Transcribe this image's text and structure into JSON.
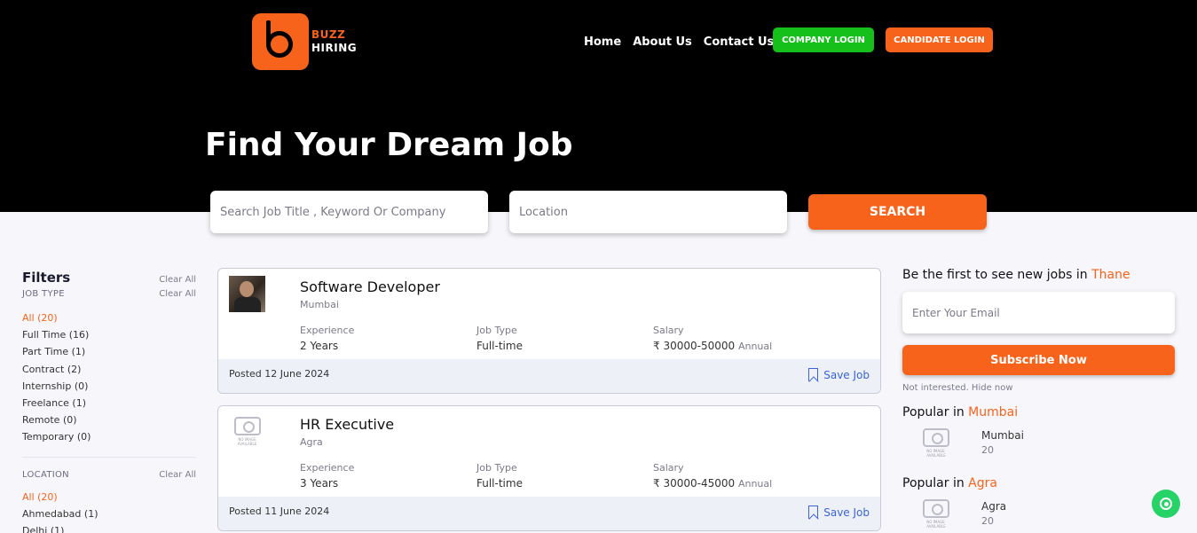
{
  "brand": {
    "line1": "BUZZ",
    "line2": "HIRING",
    "accent": "#f7631b"
  },
  "nav": {
    "home": "Home",
    "about": "About Us",
    "contact": "Contact Us"
  },
  "auth": {
    "company_login": "COMPANY LOGIN",
    "candidate_login": "CANDIDATE LOGIN"
  },
  "hero": {
    "title": "Find Your Dream Job",
    "search_placeholder": "Search Job Title , Keyword Or Company",
    "location_placeholder": "Location",
    "search_button": "SEARCH"
  },
  "filters": {
    "title": "Filters",
    "clear_all": "Clear All",
    "job_type": {
      "label": "JOB TYPE",
      "clear": "Clear All",
      "items": [
        "All (20)",
        "Full Time (16)",
        "Part Time (1)",
        "Contract (2)",
        "Internship (0)",
        "Freelance (1)",
        "Remote (0)",
        "Temporary (0)"
      ]
    },
    "location": {
      "label": "LOCATION",
      "clear": "Clear All",
      "items": [
        "All (20)",
        "Ahmedabad (1)",
        "Delhi (1)"
      ]
    }
  },
  "jobs": [
    {
      "title": "Software Developer",
      "city": "Mumbai",
      "experience_label": "Experience",
      "experience": "2 Years",
      "type_label": "Job Type",
      "type": "Full-time",
      "salary_label": "Salary",
      "salary": "₹ 30000-50000",
      "salary_period": "Annual",
      "posted": "Posted 12 June 2024",
      "save": "Save Job"
    },
    {
      "title": "HR Executive",
      "city": "Agra",
      "experience_label": "Experience",
      "experience": "3 Years",
      "type_label": "Job Type",
      "type": "Full-time",
      "salary_label": "Salary",
      "salary": "₹ 30000-45000",
      "salary_period": "Annual",
      "posted": "Posted 11 June 2024",
      "save": "Save Job"
    }
  ],
  "no_image": {
    "line1": "NO IMAGE",
    "line2": "AVAILABLE"
  },
  "subscribe": {
    "title_prefix": "Be the first to see new jobs in",
    "city": "Thane",
    "email_placeholder": "Enter Your Email",
    "button": "Subscribe Now",
    "hide": "Not interested. Hide now"
  },
  "popular": [
    {
      "prefix": "Popular in",
      "city": "Mumbai",
      "item_city": "Mumbai",
      "count": "20"
    },
    {
      "prefix": "Popular in",
      "city": "Agra",
      "item_city": "Agra",
      "count": "20"
    }
  ]
}
